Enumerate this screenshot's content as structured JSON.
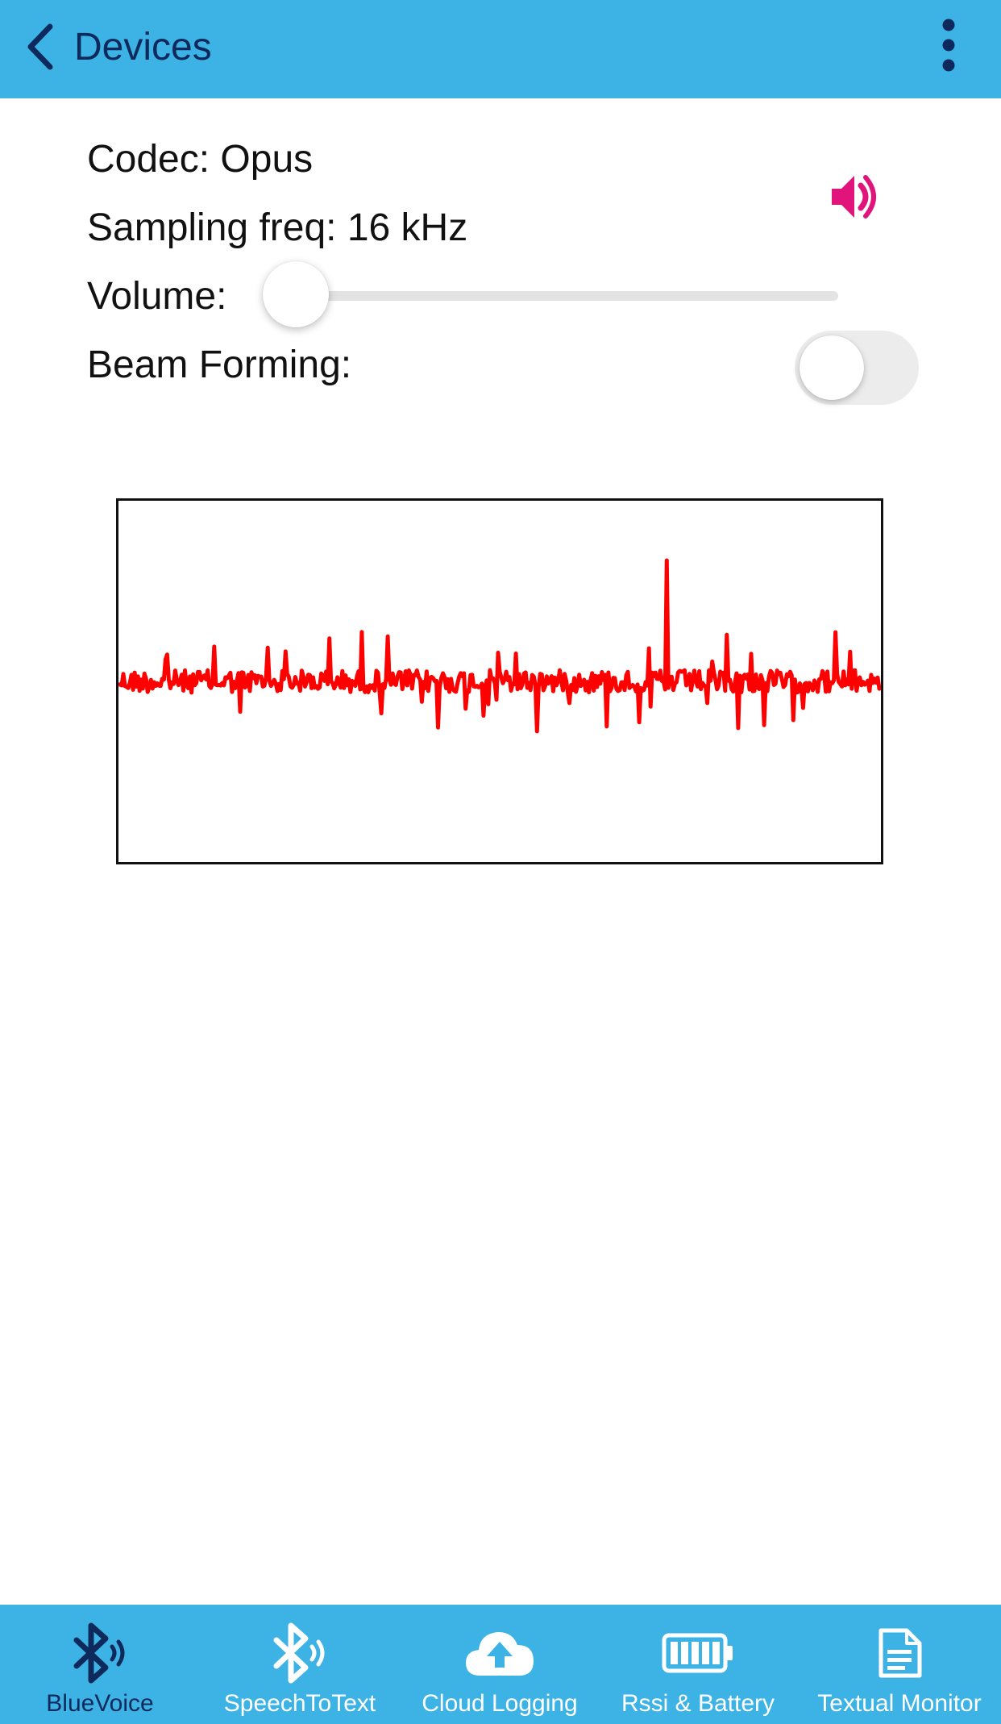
{
  "navbar": {
    "back_label": "Devices",
    "back_icon": "chevron-left-icon",
    "menu_icon": "more-vertical-icon"
  },
  "info": {
    "codec_label": "Codec: Opus",
    "sampling_label": "Sampling freq: 16 kHz",
    "volume_label": "Volume:",
    "beam_forming_label": "Beam Forming:"
  },
  "controls": {
    "speaker_icon": "speaker-volume-icon",
    "speaker_color": "#e0147a",
    "volume_level": 0,
    "beam_forming_on": false
  },
  "waveform": {
    "color": "#ff0000"
  },
  "tabbar": {
    "active_index": 0,
    "active_color": "#0e2a5c",
    "inactive_color": "#ffffff",
    "background": "#3db2e5",
    "tabs": [
      {
        "label": "BlueVoice",
        "icon": "bluetooth-audio-icon"
      },
      {
        "label": "SpeechToText",
        "icon": "bluetooth-audio-icon"
      },
      {
        "label": "Cloud Logging",
        "icon": "cloud-upload-icon"
      },
      {
        "label": "Rssi & Battery",
        "icon": "battery-icon"
      },
      {
        "label": "Textual Monitor",
        "icon": "document-icon"
      }
    ]
  }
}
